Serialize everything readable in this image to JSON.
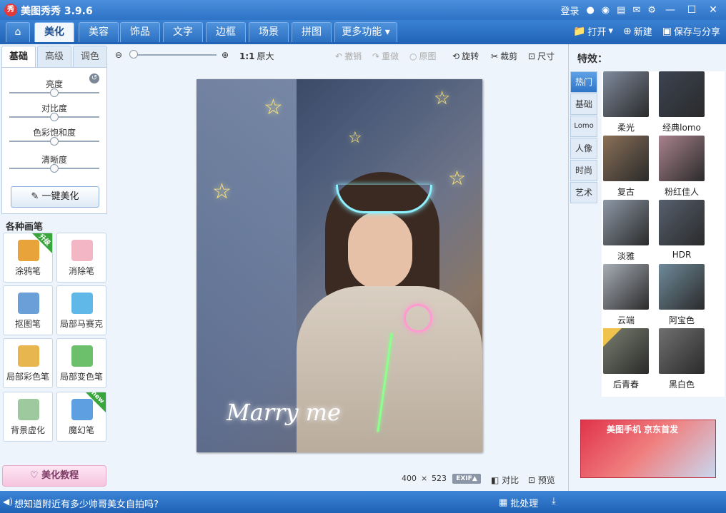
{
  "window": {
    "logo_text": "秀",
    "title": "美图秀秀 3.9.6",
    "login": "登录",
    "controls": [
      "▭",
      "—",
      "☐",
      "✕"
    ]
  },
  "tabs": [
    "美化",
    "美容",
    "饰品",
    "文字",
    "边框",
    "场景",
    "拼图"
  ],
  "tabs_more": "更多功能",
  "top_actions": {
    "open": "打开",
    "new": "新建",
    "save_share": "保存与分享"
  },
  "left": {
    "subtabs": [
      "基础",
      "高级",
      "调色"
    ],
    "sliders": [
      {
        "label": "亮度",
        "value": 0.5
      },
      {
        "label": "对比度",
        "value": 0.5
      },
      {
        "label": "色彩饱和度",
        "value": 0.5
      },
      {
        "label": "清晰度",
        "value": 0.5
      }
    ],
    "one_click": "一键美化",
    "brush_title": "各种画笔",
    "brushes": [
      {
        "label": "涂鸦笔",
        "badge": "升级",
        "color": "#e8a33a"
      },
      {
        "label": "消除笔",
        "badge": "",
        "color": "#f3b6c4"
      },
      {
        "label": "抠图笔",
        "badge": "",
        "color": "#6a9fd8"
      },
      {
        "label": "局部马赛克",
        "badge": "",
        "color": "#5fb8e8"
      },
      {
        "label": "局部彩色笔",
        "badge": "",
        "color": "#e7b64f"
      },
      {
        "label": "局部变色笔",
        "badge": "",
        "color": "#6cc06c"
      },
      {
        "label": "背景虚化",
        "badge": "",
        "color": "#9ec89e"
      },
      {
        "label": "魔幻笔",
        "badge": "new",
        "color": "#5d9fe0"
      }
    ],
    "tutorial": "美化教程"
  },
  "canvas_toolbar": {
    "ratio": "1:1",
    "original_size": "原大",
    "undo": "撤销",
    "redo": "重做",
    "original": "原图",
    "rotate": "旋转",
    "crop": "裁剪",
    "resize": "尺寸",
    "zoom_value": 0.0
  },
  "photo": {
    "caption": "Marry me"
  },
  "canvas_status": {
    "width": "400",
    "times": "×",
    "height": "523",
    "exif": "EXIF▲",
    "compare": "对比",
    "preview": "预览"
  },
  "right": {
    "title": "特效：",
    "categories": [
      "热门",
      "基础",
      "Lomo",
      "人像",
      "时尚",
      "艺术"
    ],
    "effects": [
      {
        "label": "柔光",
        "tone": "#7f8a9c"
      },
      {
        "label": "经典lomo",
        "tone": "#3c4452"
      },
      {
        "label": "复古",
        "tone": "#8a7058"
      },
      {
        "label": "粉红佳人",
        "tone": "#a8828c"
      },
      {
        "label": "淡雅",
        "tone": "#8d98a6"
      },
      {
        "label": "HDR",
        "tone": "#56606e"
      },
      {
        "label": "云端",
        "tone": "#a7adb6"
      },
      {
        "label": "阿宝色",
        "tone": "#6f8a9a"
      },
      {
        "label": "后青春",
        "tone": "#7a8070",
        "hot": true
      },
      {
        "label": "黑白色",
        "tone": "#707070"
      }
    ],
    "ad_text": "美图手机 京东首发"
  },
  "bottom": {
    "tip": "想知道附近有多少帅哥美女自拍吗?",
    "batch": "批处理"
  },
  "colors": {
    "accent": "#2f73c6",
    "panel": "#eef4fb"
  }
}
